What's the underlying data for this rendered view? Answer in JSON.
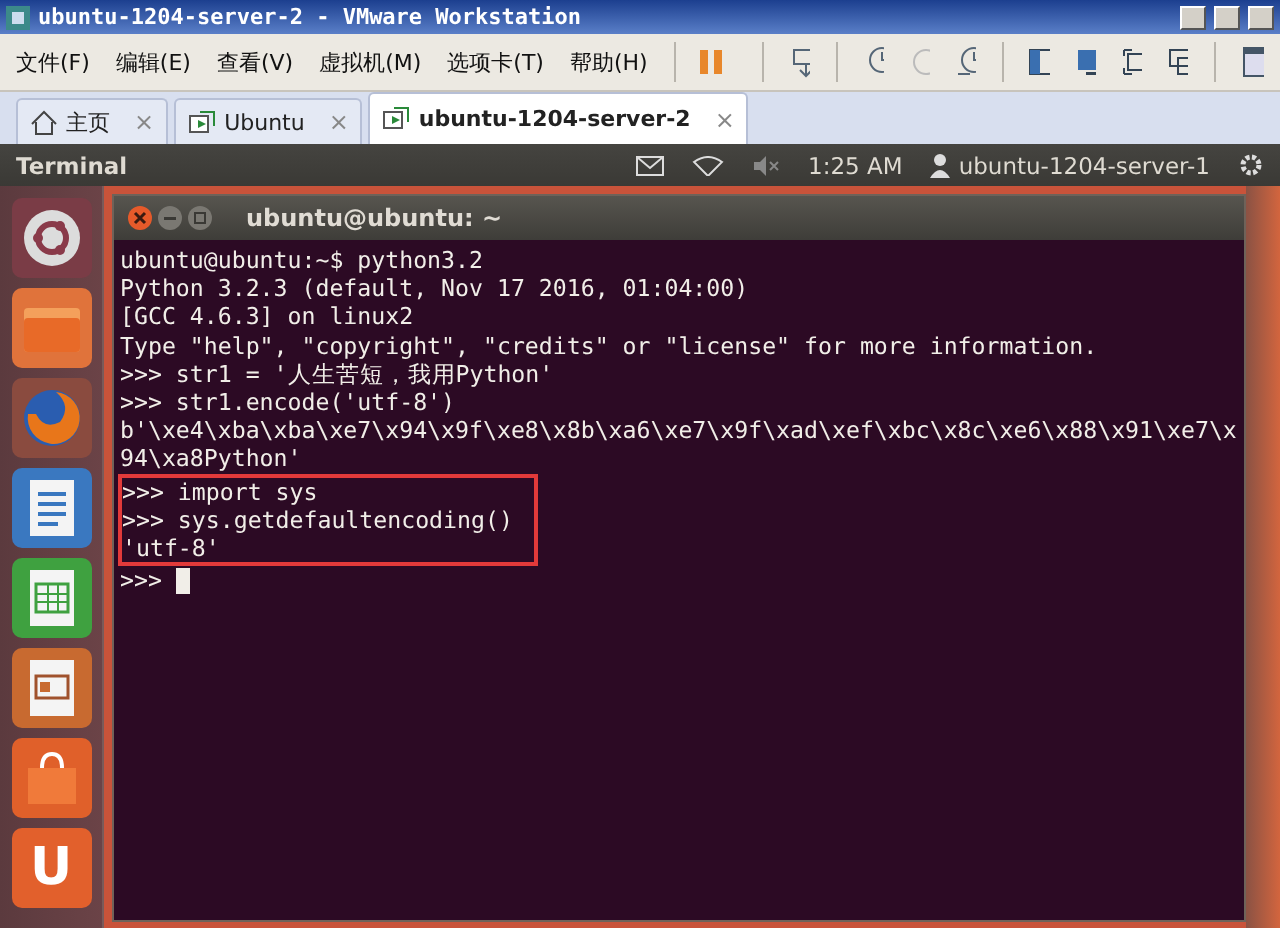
{
  "window": {
    "title": "ubuntu-1204-server-2 - VMware Workstation"
  },
  "menu": [
    "文件(F)",
    "编辑(E)",
    "查看(V)",
    "虚拟机(M)",
    "选项卡(T)",
    "帮助(H)"
  ],
  "tabs": [
    {
      "label": "主页",
      "kind": "home",
      "selected": false,
      "close": "×"
    },
    {
      "label": "Ubuntu",
      "kind": "vm",
      "selected": false,
      "close": "×"
    },
    {
      "label": "ubuntu-1204-server-2",
      "kind": "vm",
      "selected": true,
      "close": "×"
    }
  ],
  "panel": {
    "app": "Terminal",
    "time": "1:25 AM",
    "user": "ubuntu-1204-server-1"
  },
  "launcher": [
    {
      "kind": "dash"
    },
    {
      "kind": "files"
    },
    {
      "kind": "firefox"
    },
    {
      "kind": "writer"
    },
    {
      "kind": "calc"
    },
    {
      "kind": "impress"
    },
    {
      "kind": "software"
    },
    {
      "kind": "ubuntuone",
      "glyph": "U"
    }
  ],
  "terminal": {
    "title": "ubuntu@ubuntu: ~",
    "lines": [
      {
        "text": "ubuntu@ubuntu:~$ python3.2",
        "highlighted": false
      },
      {
        "text": "Python 3.2.3 (default, Nov 17 2016, 01:04:00)",
        "highlighted": false
      },
      {
        "text": "[GCC 4.6.3] on linux2",
        "highlighted": false
      },
      {
        "text": "Type \"help\", \"copyright\", \"credits\" or \"license\" for more information.",
        "highlighted": false
      },
      {
        "text": ">>> str1 = '人生苦短，我用Python'",
        "highlighted": false
      },
      {
        "text": ">>> str1.encode('utf-8')",
        "highlighted": false
      },
      {
        "text": "b'\\xe4\\xba\\xba\\xe7\\x94\\x9f\\xe8\\x8b\\xa6\\xe7\\x9f\\xad\\xef\\xbc\\x8c\\xe6\\x88\\x91\\xe7\\x",
        "highlighted": false
      },
      {
        "text": "94\\xa8Python'",
        "highlighted": false
      },
      {
        "text": ">>> import sys",
        "highlighted": true
      },
      {
        "text": ">>> sys.getdefaultencoding()",
        "highlighted": true
      },
      {
        "text": "'utf-8'",
        "highlighted": true
      },
      {
        "text": ">>> ",
        "highlighted": false,
        "cursor": true
      }
    ]
  }
}
